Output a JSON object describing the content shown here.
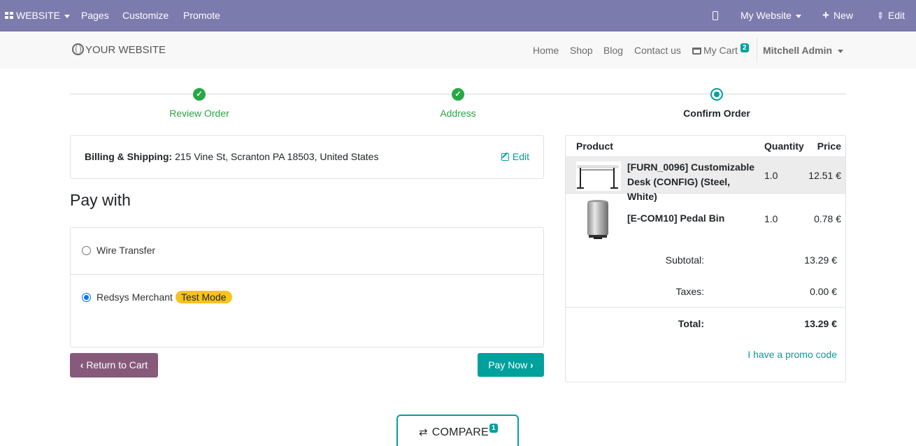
{
  "topbar": {
    "website_label": "WEBSITE",
    "pages": "Pages",
    "customize": "Customize",
    "promote": "Promote",
    "my_website": "My Website",
    "new": "New",
    "edit": "Edit",
    "background": "#7c7bad"
  },
  "header": {
    "logo": "YOUR WEBSITE",
    "nav": [
      "Home",
      "Shop",
      "Blog",
      "Contact us"
    ],
    "cart_label": "My Cart",
    "cart_count": "2",
    "user": "Mitchell Admin"
  },
  "wizard": {
    "steps": [
      {
        "label": "Review Order",
        "state": "done"
      },
      {
        "label": "Address",
        "state": "done"
      },
      {
        "label": "Confirm Order",
        "state": "current"
      }
    ]
  },
  "billing": {
    "label": "Billing & Shipping:",
    "address": " 215 Vine St, Scranton PA 18503, United States",
    "edit": "Edit"
  },
  "payment": {
    "heading": "Pay with",
    "options": [
      {
        "label": "Wire Transfer",
        "selected": false
      },
      {
        "label": "Redsys Merchant",
        "selected": true,
        "badge": "Test Mode"
      }
    ]
  },
  "buttons": {
    "return_to_cart": "Return to Cart",
    "pay_now": "Pay Now"
  },
  "summary": {
    "headers": {
      "product": "Product",
      "quantity": "Quantity",
      "price": "Price"
    },
    "lines": [
      {
        "name": "[FURN_0096] Customizable Desk (CONFIG) (Steel, White)",
        "qty": "1.0",
        "price": "12.51 €"
      },
      {
        "name": "[E-COM10] Pedal Bin",
        "qty": "1.0",
        "price": "0.78 €"
      }
    ],
    "subtotal_label": "Subtotal:",
    "subtotal": "13.29 €",
    "taxes_label": "Taxes:",
    "taxes": "0.00 €",
    "total_label": "Total:",
    "total": "13.29 €",
    "promo": "I have a promo code"
  },
  "compare": {
    "label": "COMPARE",
    "count": "1"
  },
  "colors": {
    "primary": "#00a09d",
    "secondary": "#875a7b",
    "success": "#28a745",
    "warning": "#f9c31c"
  }
}
